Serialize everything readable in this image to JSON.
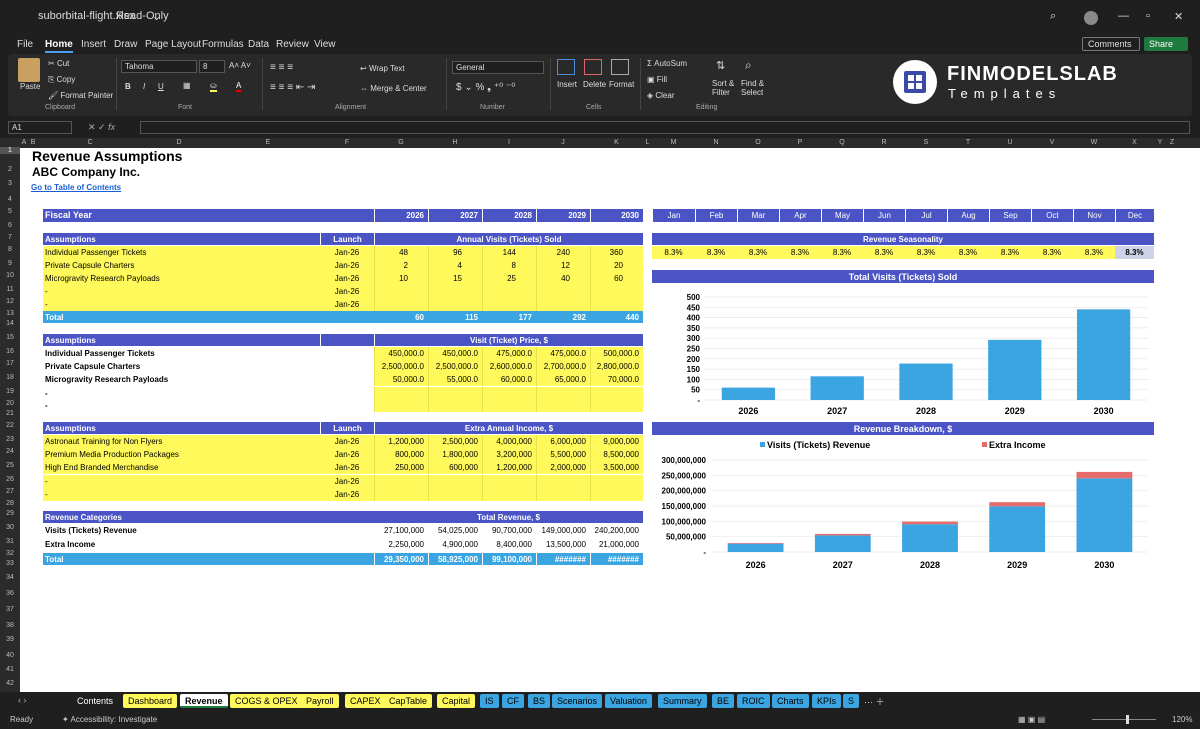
{
  "window": {
    "title": "suborbital-flight.xlsx",
    "mode": "Read-Only"
  },
  "menus": [
    "File",
    "Home",
    "Insert",
    "Draw",
    "Page Layout",
    "Formulas",
    "Data",
    "Review",
    "View"
  ],
  "header_buttons": {
    "comments": "Comments",
    "share": "Share"
  },
  "ribbon": {
    "paste": "Paste",
    "cut": "Cut",
    "copy": "Copy",
    "format_painter": "Format Painter",
    "clipboard": "Clipboard",
    "font_name": "Tahoma",
    "font_size": "8",
    "font": "Font",
    "wrap": "Wrap Text",
    "merge": "Merge & Center",
    "alignment": "Alignment",
    "number_format": "General",
    "number": "Number",
    "insert": "Insert",
    "delete": "Delete",
    "format": "Format",
    "cells": "Cells",
    "autosum": "AutoSum",
    "fill": "Fill",
    "clear": "Clear",
    "sort": "Sort &",
    "sort2": "Filter",
    "find": "Find &",
    "find2": "Select",
    "editing": "Editing"
  },
  "brand": {
    "name": "FINMODELSLAB",
    "sub": "Templates"
  },
  "namebox": "A1",
  "sheet": {
    "title": "Revenue Assumptions",
    "company": "ABC Company Inc.",
    "toc": "Go to Table of Contents",
    "fiscal_year": "Fiscal Year",
    "years": [
      "2026",
      "2027",
      "2028",
      "2029",
      "2030"
    ],
    "months": [
      "Jan",
      "Feb",
      "Mar",
      "Apr",
      "May",
      "Jun",
      "Jul",
      "Aug",
      "Sep",
      "Oct",
      "Nov",
      "Dec"
    ],
    "assumptions": "Assumptions",
    "launch": "Launch",
    "annual_visits": "Annual Visits (Tickets) Sold",
    "visits_rows": [
      {
        "name": "Individual Passenger Tickets",
        "launch": "Jan-26",
        "vals": [
          "48",
          "96",
          "144",
          "240",
          "360"
        ]
      },
      {
        "name": "Private Capsule Charters",
        "launch": "Jan-26",
        "vals": [
          "2",
          "4",
          "8",
          "12",
          "20"
        ]
      },
      {
        "name": "Microgravity Research Payloads",
        "launch": "Jan-26",
        "vals": [
          "10",
          "15",
          "25",
          "40",
          "60"
        ]
      },
      {
        "name": "-",
        "launch": "Jan-26",
        "vals": [
          "",
          "",
          "",
          "",
          ""
        ]
      },
      {
        "name": "-",
        "launch": "Jan-26",
        "vals": [
          "",
          "",
          "",
          "",
          ""
        ]
      }
    ],
    "total": "Total",
    "visits_total": [
      "60",
      "115",
      "177",
      "292",
      "440"
    ],
    "price_title": "Visit (Ticket) Price, $",
    "price_rows": [
      {
        "name": "Individual Passenger Tickets",
        "vals": [
          "450,000.0",
          "450,000.0",
          "475,000.0",
          "475,000.0",
          "500,000.0"
        ]
      },
      {
        "name": "Private Capsule Charters",
        "vals": [
          "2,500,000.0",
          "2,500,000.0",
          "2,600,000.0",
          "2,700,000.0",
          "2,800,000.0"
        ]
      },
      {
        "name": "Microgravity Research Payloads",
        "vals": [
          "50,000.0",
          "55,000.0",
          "60,000.0",
          "65,000.0",
          "70,000.0"
        ]
      },
      {
        "name": "-",
        "vals": [
          "",
          "",
          "",
          "",
          ""
        ]
      },
      {
        "name": "-",
        "vals": [
          "",
          "",
          "",
          "",
          ""
        ]
      }
    ],
    "extra_title": "Extra Annual Income, $",
    "extra_rows": [
      {
        "name": "Astronaut Training for Non Flyers",
        "launch": "Jan-26",
        "vals": [
          "1,200,000",
          "2,500,000",
          "4,000,000",
          "6,000,000",
          "9,000,000"
        ]
      },
      {
        "name": "Premium Media Production Packages",
        "launch": "Jan-26",
        "vals": [
          "800,000",
          "1,800,000",
          "3,200,000",
          "5,500,000",
          "8,500,000"
        ]
      },
      {
        "name": "High End Branded Merchandise",
        "launch": "Jan-26",
        "vals": [
          "250,000",
          "600,000",
          "1,200,000",
          "2,000,000",
          "3,500,000"
        ]
      },
      {
        "name": "-",
        "launch": "Jan-26",
        "vals": [
          "",
          "",
          "",
          "",
          ""
        ]
      },
      {
        "name": "-",
        "launch": "Jan-26",
        "vals": [
          "",
          "",
          "",
          "",
          ""
        ]
      }
    ],
    "rev_cat": "Revenue Categories",
    "total_rev": "Total Revenue, $",
    "rev_rows": [
      {
        "name": "Visits (Tickets) Revenue",
        "vals": [
          "27,100,000",
          "54,025,000",
          "90,700,000",
          "149,000,000",
          "240,200,000"
        ]
      },
      {
        "name": "Extra Income",
        "vals": [
          "2,250,000",
          "4,900,000",
          "8,400,000",
          "13,500,000",
          "21,000,000"
        ]
      }
    ],
    "rev_total": [
      "29,350,000",
      "58,925,000",
      "99,100,000",
      "#######",
      "#######"
    ],
    "seasonality_title": "Revenue Seasonality",
    "seasonality": [
      "8.3%",
      "8.3%",
      "8.3%",
      "8.3%",
      "8.3%",
      "8.3%",
      "8.3%",
      "8.3%",
      "8.3%",
      "8.3%",
      "8.3%",
      "8.3%"
    ]
  },
  "chart_data": [
    {
      "type": "bar",
      "title": "Total Visits (Tickets) Sold",
      "categories": [
        "2026",
        "2027",
        "2028",
        "2029",
        "2030"
      ],
      "values": [
        60,
        115,
        177,
        292,
        440
      ],
      "ylim": [
        0,
        500
      ],
      "yticks": [
        "500",
        "450",
        "400",
        "350",
        "300",
        "250",
        "200",
        "150",
        "100",
        "50",
        "-"
      ]
    },
    {
      "type": "bar",
      "title": "Revenue Breakdown, $",
      "categories": [
        "2026",
        "2027",
        "2028",
        "2029",
        "2030"
      ],
      "series": [
        {
          "name": "Visits (Tickets) Revenue",
          "values": [
            27100000,
            54025000,
            90700000,
            149000000,
            240200000
          ],
          "color": "#3aa5e0"
        },
        {
          "name": "Extra Income",
          "values": [
            2250000,
            4900000,
            8400000,
            13500000,
            21000000
          ],
          "color": "#e86b6b"
        }
      ],
      "ylim": [
        0,
        300000000
      ],
      "yticks": [
        "300,000,000",
        "250,000,000",
        "200,000,000",
        "150,000,000",
        "100,000,000",
        "50,000,000",
        "-"
      ]
    }
  ],
  "tabs": [
    {
      "label": "Contents",
      "bg": "#1f1f1f",
      "fg": "#fff"
    },
    {
      "label": "Dashboard",
      "bg": "#fff95c",
      "fg": "#000"
    },
    {
      "label": "Revenue",
      "bg": "#ffffff",
      "fg": "#000"
    },
    {
      "label": "COGS & OPEX",
      "bg": "#fff95c",
      "fg": "#000"
    },
    {
      "label": "Payroll",
      "bg": "#fff95c",
      "fg": "#000"
    },
    {
      "label": "CAPEX",
      "bg": "#fff95c",
      "fg": "#000"
    },
    {
      "label": "CapTable",
      "bg": "#fff95c",
      "fg": "#000"
    },
    {
      "label": "Capital",
      "bg": "#fff95c",
      "fg": "#000"
    },
    {
      "label": "IS",
      "bg": "#3aa5e0",
      "fg": "#000"
    },
    {
      "label": "CF",
      "bg": "#3aa5e0",
      "fg": "#000"
    },
    {
      "label": "BS",
      "bg": "#3aa5e0",
      "fg": "#000"
    },
    {
      "label": "Scenarios",
      "bg": "#3aa5e0",
      "fg": "#000"
    },
    {
      "label": "Valuation",
      "bg": "#3aa5e0",
      "fg": "#000"
    },
    {
      "label": "Summary",
      "bg": "#3aa5e0",
      "fg": "#000"
    },
    {
      "label": "BE",
      "bg": "#3aa5e0",
      "fg": "#000"
    },
    {
      "label": "ROIC",
      "bg": "#3aa5e0",
      "fg": "#000"
    },
    {
      "label": "Charts",
      "bg": "#3aa5e0",
      "fg": "#000"
    },
    {
      "label": "KPIs",
      "bg": "#3aa5e0",
      "fg": "#000"
    },
    {
      "label": "S",
      "bg": "#3aa5e0",
      "fg": "#000"
    }
  ],
  "status": {
    "ready": "Ready",
    "accessibility": "Accessibility: Investigate",
    "zoom": "120%"
  }
}
